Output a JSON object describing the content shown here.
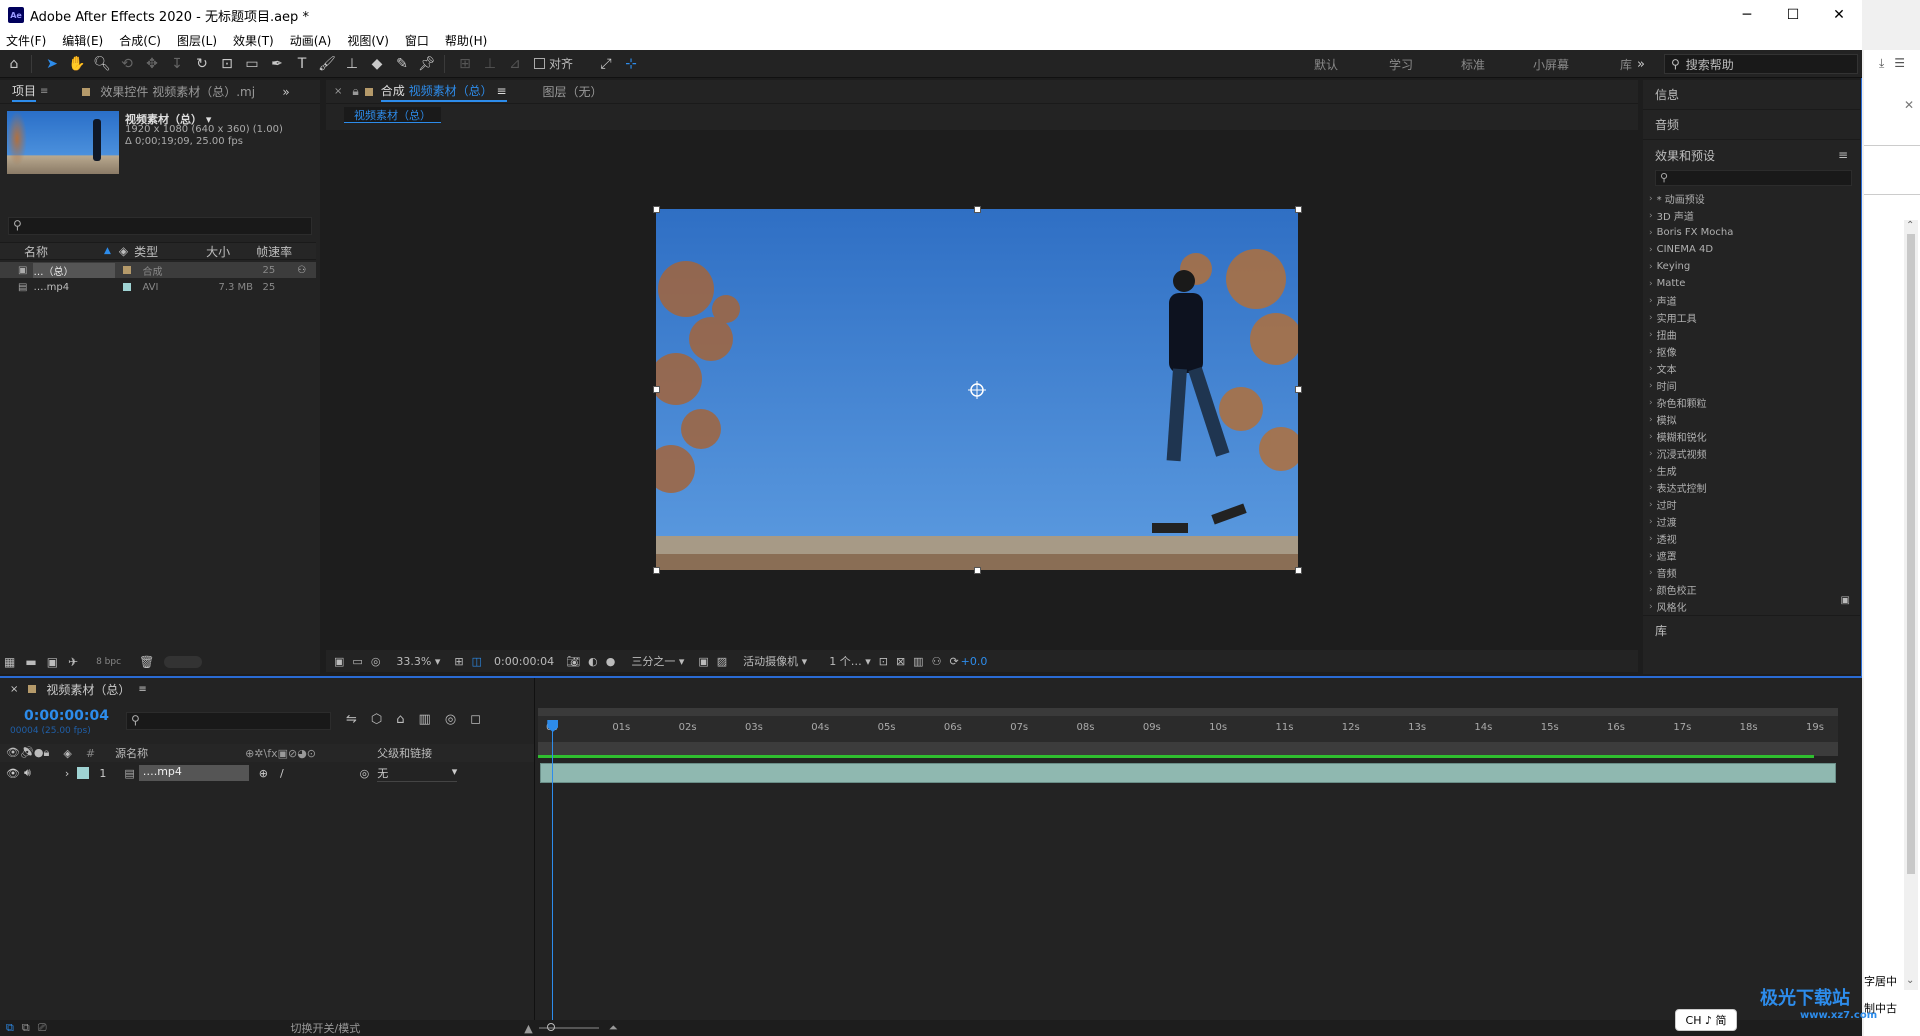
{
  "app": {
    "title": "Adobe After Effects 2020 - 无标题项目.aep *",
    "logo": "Ae",
    "window_controls": [
      "minimize-icon",
      "maximize-icon",
      "close-icon"
    ]
  },
  "menu": [
    "文件(F)",
    "编辑(E)",
    "合成(C)",
    "图层(L)",
    "效果(T)",
    "动画(A)",
    "视图(V)",
    "窗口",
    "帮助(H)"
  ],
  "toolbar": {
    "align_label": "对齐",
    "workspaces": [
      "默认",
      "学习",
      "标准",
      "小屏幕",
      "库"
    ],
    "search_placeholder": "搜索帮助"
  },
  "project": {
    "tabs": [
      "项目",
      "效果控件 视频素材（总）.mj"
    ],
    "thumb_title": "视频素材（总）",
    "thumb_info1": "1920 x 1080  (640 x 360) (1.00)",
    "thumb_info2": "Δ 0;00;19;09, 25.00 fps",
    "columns": [
      "名称",
      "类型",
      "大小",
      "帧速率"
    ],
    "items": [
      {
        "name": "…（总）",
        "type": "合成",
        "size": "",
        "fps": "25",
        "color": "#b59a6a"
      },
      {
        "name": "….mp4",
        "type": "AVI",
        "size": "7.3 MB",
        "fps": "25",
        "color": "#9fd3d3"
      }
    ],
    "bpc": "8 bpc"
  },
  "comp": {
    "tab_label": "合成",
    "tab_name": "视频素材（总）",
    "layer_tab": "图层（无）",
    "breadcrumb": "视频素材（总）"
  },
  "viewer_footer": {
    "zoom": "33.3%",
    "timecode": "0:00:00:04",
    "resolution": "三分之一",
    "camera": "活动摄像机",
    "views": "1 个…",
    "exposure": "+0.0"
  },
  "right_panel": {
    "info": "信息",
    "audio": "音频",
    "effects_title": "效果和预设",
    "effects": [
      "* 动画预设",
      "3D 声道",
      "Boris FX Mocha",
      "CINEMA 4D",
      "Keying",
      "Matte",
      "声道",
      "实用工具",
      "扭曲",
      "抠像",
      "文本",
      "时间",
      "杂色和颗粒",
      "模拟",
      "模糊和锐化",
      "沉浸式视频",
      "生成",
      "表达式控制",
      "过时",
      "过渡",
      "透视",
      "遮罩",
      "音频",
      "颜色校正",
      "风格化"
    ],
    "library": "库"
  },
  "timeline": {
    "comp_name": "视频素材（总）",
    "timecode": "0:00:00:04",
    "frame_info": "00004 (25.00 fps)",
    "col_source": "源名称",
    "col_parent": "父级和链接",
    "layer_num": "1",
    "layer_name": "….mp4",
    "parent_value": "无",
    "ruler": [
      "0s",
      "01s",
      "02s",
      "03s",
      "04s",
      "05s",
      "06s",
      "07s",
      "08s",
      "09s",
      "10s",
      "11s",
      "12s",
      "13s",
      "14s",
      "15s",
      "16s",
      "17s",
      "18s",
      "19s"
    ],
    "playhead_fraction": 0.011
  },
  "status": {
    "toggle_label": "切换开关/模式"
  },
  "ime": {
    "label": "CH ♪ 简"
  },
  "bg_window": {
    "text1": "字居中",
    "text2": "制中古"
  },
  "watermark": {
    "text": "极光下载站",
    "url": "www.xz7.com"
  },
  "colors": {
    "accent": "#2d8ceb",
    "track": "#8fb8b0",
    "panel": "#232323"
  }
}
